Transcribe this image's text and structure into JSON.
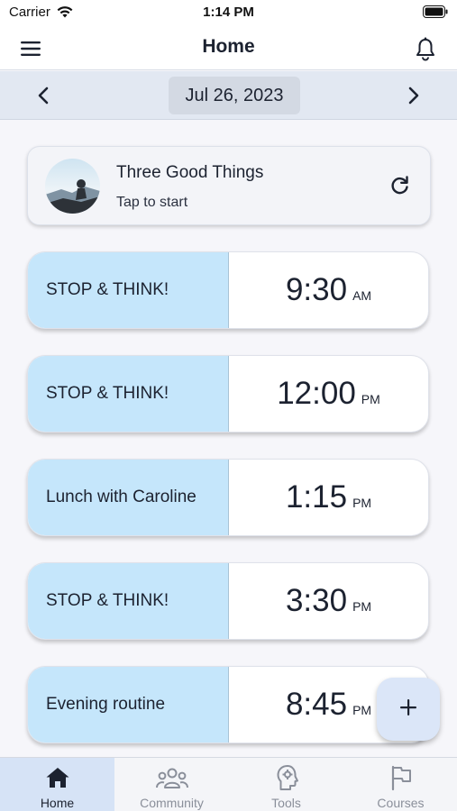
{
  "status_bar": {
    "carrier": "Carrier",
    "time": "1:14 PM"
  },
  "header": {
    "title": "Home"
  },
  "date_bar": {
    "date": "Jul 26, 2023"
  },
  "three_good_things": {
    "title": "Three Good Things",
    "subtitle": "Tap to start"
  },
  "events": [
    {
      "name": "STOP & THINK!",
      "time": "9:30",
      "ampm": "AM"
    },
    {
      "name": "STOP & THINK!",
      "time": "12:00",
      "ampm": "PM"
    },
    {
      "name": "Lunch with Caroline",
      "time": "1:15",
      "ampm": "PM"
    },
    {
      "name": "STOP & THINK!",
      "time": "3:30",
      "ampm": "PM"
    },
    {
      "name": "Evening routine",
      "time": "8:45",
      "ampm": "PM"
    }
  ],
  "fab": {
    "icon": "plus-icon"
  },
  "bottom_nav": {
    "items": [
      {
        "label": "Home",
        "icon": "home-icon",
        "active": true
      },
      {
        "label": "Community",
        "icon": "community-icon",
        "active": false
      },
      {
        "label": "Tools",
        "icon": "tools-icon",
        "active": false
      },
      {
        "label": "Courses",
        "icon": "flag-icon",
        "active": false
      }
    ]
  },
  "colors": {
    "event_accent": "#c5e6fb",
    "active_nav": "#d6e3f6",
    "fab": "#dbe6f8",
    "text": "#1c2230"
  }
}
